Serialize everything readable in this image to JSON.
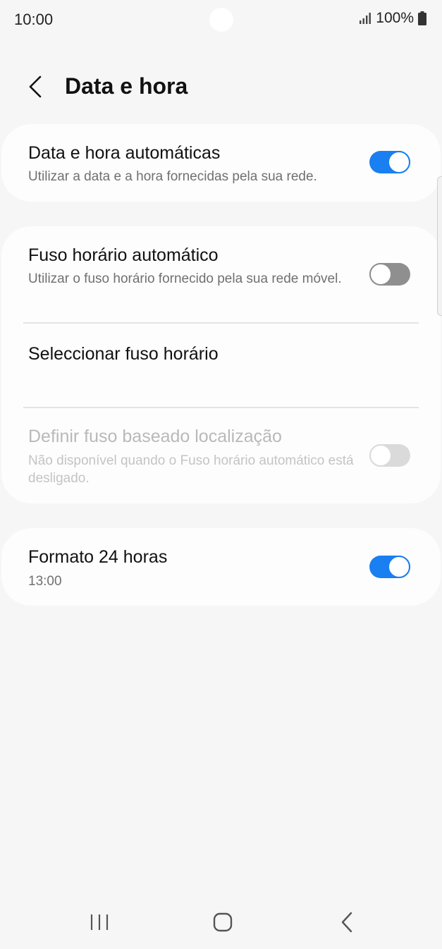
{
  "status_bar": {
    "time": "10:00",
    "battery": "100%",
    "icons": [
      "signal-icon",
      "battery-icon"
    ]
  },
  "header": {
    "title": "Data e hora",
    "back_icon": "back-arrow-icon"
  },
  "settings": {
    "auto_datetime": {
      "title": "Data e hora automáticas",
      "subtitle": "Utilizar a data e a hora fornecidas pela sua rede.",
      "enabled": true
    },
    "auto_timezone": {
      "title": "Fuso horário automático",
      "subtitle": "Utilizar o fuso horário fornecido pela sua rede móvel.",
      "enabled": false
    },
    "select_timezone": {
      "title": "Seleccionar fuso horário"
    },
    "location_timezone": {
      "title": "Definir fuso baseado localização",
      "subtitle": "Não disponível quando o Fuso horário automático está desligado.",
      "enabled": false,
      "disabled": true
    },
    "format_24h": {
      "title": "Formato 24 horas",
      "subtitle": "13:00",
      "enabled": true
    }
  },
  "nav_bar": {
    "icons": [
      "recents-icon",
      "home-icon",
      "back-icon"
    ]
  },
  "colors": {
    "accent": "#1a7ff0",
    "background": "#f6f6f6",
    "card": "#fdfdfd",
    "toggle_off": "#8f8f8f",
    "disabled_text": "#b9b9b9"
  }
}
